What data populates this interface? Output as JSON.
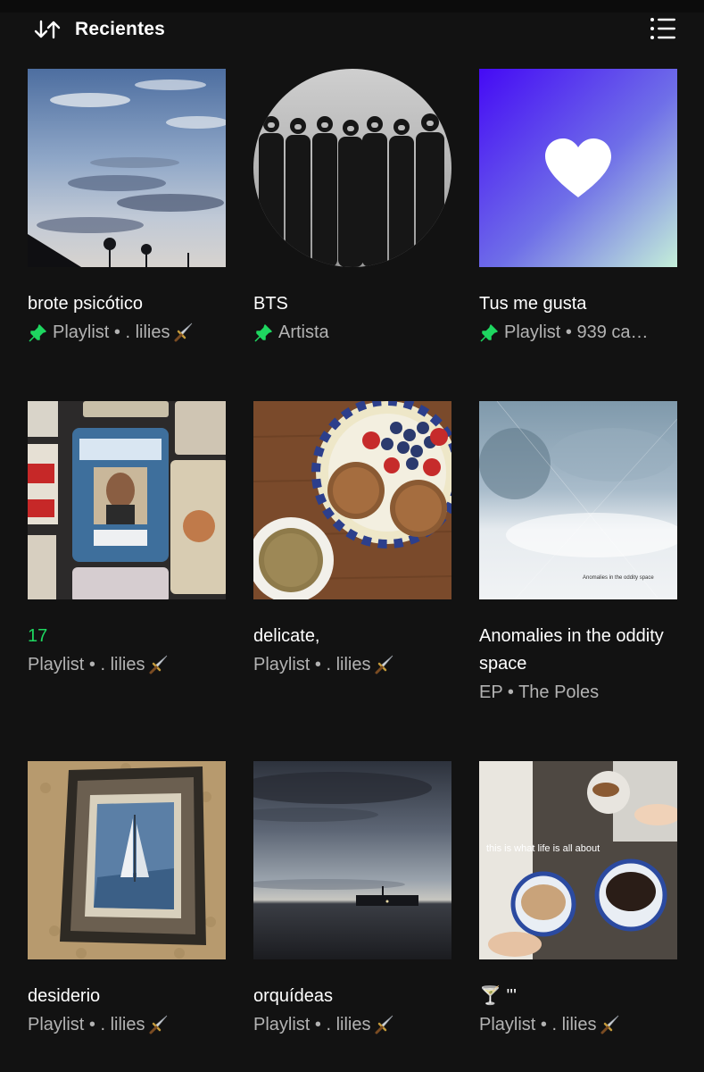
{
  "header": {
    "sort_label": "Recientes"
  },
  "colors": {
    "background": "#121212",
    "accent": "#1ed760",
    "secondary_text": "#b3b3b3",
    "liked_gradient": [
      "#450af5",
      "#c4efd9"
    ]
  },
  "items": [
    {
      "title": "brote psicótico",
      "subtitle": "Playlist • . lilies",
      "pinned": true,
      "emoji": "dagger"
    },
    {
      "title": "BTS",
      "subtitle": "Artista",
      "pinned": true
    },
    {
      "title": "Tus me gusta",
      "subtitle": "Playlist • 939 ca…",
      "pinned": true
    },
    {
      "title": "17",
      "subtitle": "Playlist • . lilies",
      "pinned": false,
      "emoji": "dagger",
      "title_active": true
    },
    {
      "title": "delicate,",
      "subtitle": "Playlist • . lilies",
      "pinned": false,
      "emoji": "dagger"
    },
    {
      "title": "Anomalies in the oddity space",
      "subtitle": "EP • The Poles",
      "pinned": false,
      "cover_text": "Anomalies in the oddity space"
    },
    {
      "title": "desiderio",
      "subtitle": "Playlist • . lilies",
      "pinned": false,
      "emoji": "dagger"
    },
    {
      "title": "orquídeas",
      "subtitle": "Playlist • . lilies",
      "pinned": false,
      "emoji": "dagger"
    },
    {
      "title": "🍸 '''",
      "subtitle": "Playlist • . lilies",
      "pinned": false,
      "emoji": "dagger",
      "cover_text": "this is what life is all about"
    }
  ]
}
